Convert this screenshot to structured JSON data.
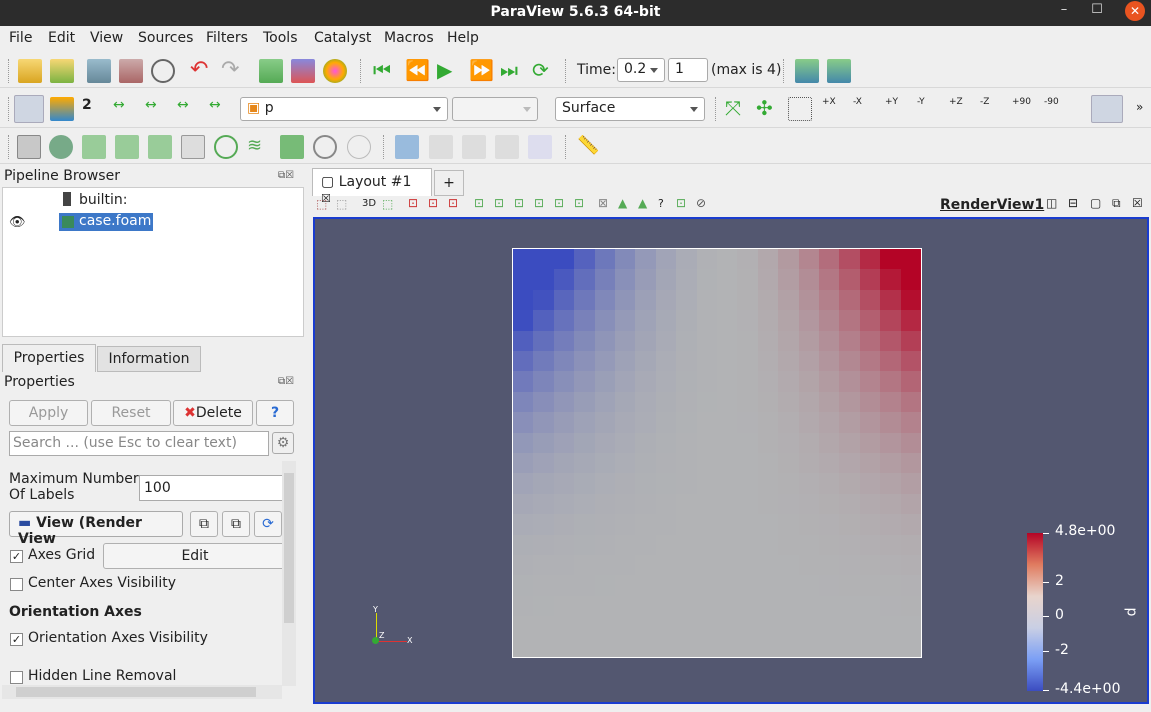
{
  "window": {
    "title": "ParaView 5.6.3 64-bit"
  },
  "menu": [
    "File",
    "Edit",
    "View",
    "Sources",
    "Filters",
    "Tools",
    "Catalyst",
    "Macros",
    "Help"
  ],
  "toolbar": {
    "time_label": "Time:",
    "time_value": "0.2",
    "step_value": "1",
    "max_label": "(max is 4)",
    "array": "p",
    "component": "",
    "representation": "Surface"
  },
  "camera_labels": {
    "px": "+X",
    "mx": "-X",
    "py": "+Y",
    "my": "-Y",
    "pz": "+Z",
    "mz": "-Z",
    "r90": "+90",
    "rm90": "-90"
  },
  "pipeline": {
    "title": "Pipeline Browser",
    "builtin": "builtin:",
    "source": "case.foam"
  },
  "tabs": {
    "properties": "Properties",
    "information": "Information"
  },
  "properties": {
    "title": "Properties",
    "apply": "Apply",
    "reset": "Reset",
    "delete": "Delete",
    "help": "?",
    "search_placeholder": "Search ... (use Esc to clear text)",
    "max_labels_label": "Maximum Number Of Labels",
    "max_labels_value": "100",
    "view_label": "View (Render View",
    "axes_grid": "Axes Grid",
    "edit": "Edit",
    "center_axes": "Center Axes Visibility",
    "orientation_axes": "Orientation Axes",
    "orientation_axes_visibility": "Orientation Axes Visibility",
    "hidden_line": "Hidden Line Removal"
  },
  "layout": {
    "tab": "Layout #1",
    "add": "+",
    "view_name": "RenderView1",
    "mode3d": "3D"
  },
  "colorbar": {
    "title": "p",
    "labels": [
      "4.8e+00",
      "2",
      "0",
      "-2",
      "-4.4e+00"
    ]
  },
  "axes": {
    "y": "Y",
    "z": "Z",
    "x": "X"
  },
  "colors": {
    "accent": "#1a3ccf",
    "render_bg": "#535770",
    "selection": "#3d78c8"
  }
}
